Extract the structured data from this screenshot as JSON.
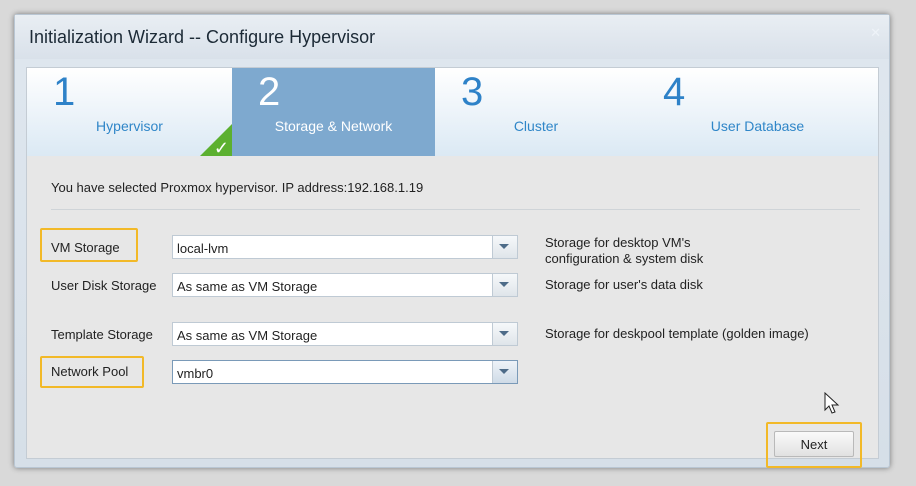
{
  "window": {
    "title": "Initialization Wizard -- Configure Hypervisor",
    "close_glyph": "✕"
  },
  "steps": [
    {
      "number": "1",
      "label": "Hypervisor",
      "state": "done"
    },
    {
      "number": "2",
      "label": "Storage & Network",
      "state": "active"
    },
    {
      "number": "3",
      "label": "Cluster",
      "state": "pending"
    },
    {
      "number": "4",
      "label": "User Database",
      "state": "pending"
    }
  ],
  "info_text": "You have selected Proxmox hypervisor. IP address:192.168.1.19",
  "fields": {
    "vm_storage": {
      "label": "VM Storage",
      "value": "local-lvm",
      "hint_line1": "Storage for desktop VM's",
      "hint_line2": "configuration & system disk"
    },
    "user_disk_storage": {
      "label": "User Disk Storage",
      "value": "As same as VM Storage",
      "hint": "Storage for user's data disk"
    },
    "template_storage": {
      "label": "Template Storage",
      "value": "As same as VM Storage",
      "hint": "Storage for deskpool template (golden image)"
    },
    "network_pool": {
      "label": "Network Pool",
      "value": "vmbr0"
    }
  },
  "buttons": {
    "next": "Next"
  },
  "icons": {
    "done_check": "checkmark-icon",
    "combo_arrow": "chevron-down-icon",
    "cursor": "mouse-pointer-icon"
  },
  "colors": {
    "active_step": "#7ea9cf",
    "step_text": "#2f86c8",
    "done_badge": "#5cb030",
    "highlight": "#f2b928"
  }
}
